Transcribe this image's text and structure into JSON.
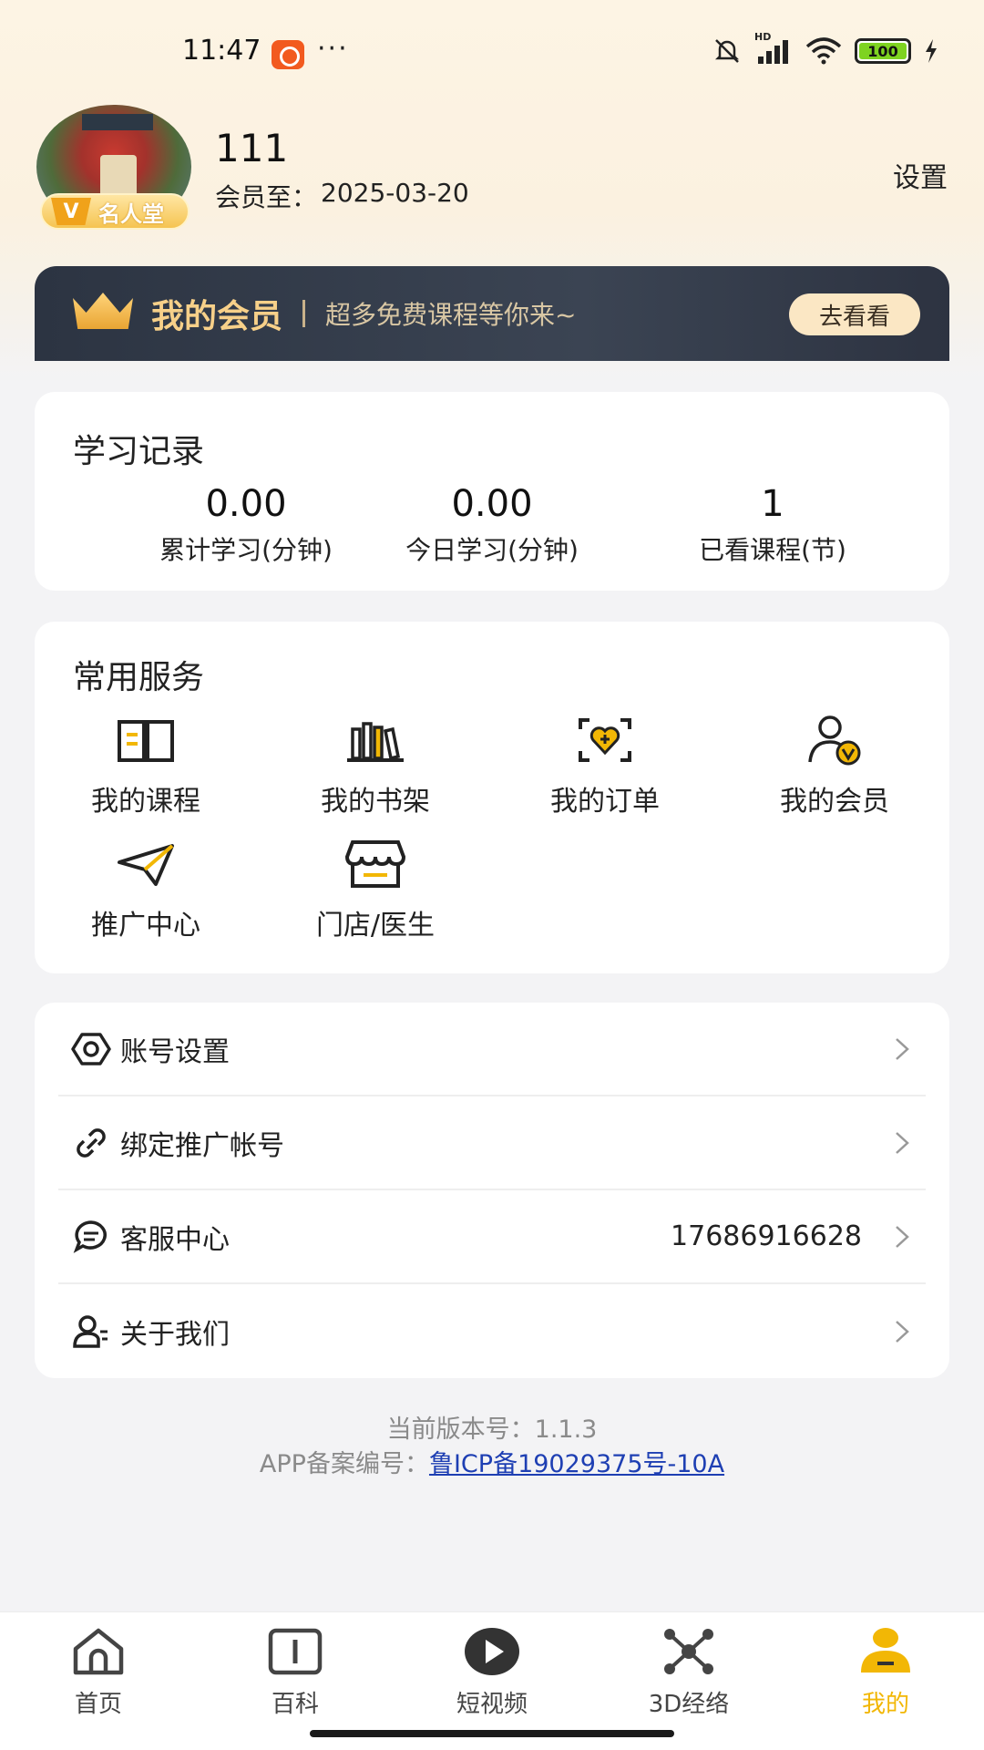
{
  "status_bar": {
    "time": "11:47",
    "dots": "···",
    "network": "HD",
    "battery": "100"
  },
  "profile": {
    "avatar_alt": "avatar",
    "badge": "名人堂",
    "badge_letter": "V",
    "username": "111",
    "member_prefix": "会员至：",
    "member_date": "2025-03-20",
    "settings_label": "设置"
  },
  "member_banner": {
    "title": "我的会员",
    "subtitle": "超多免费课程等你来~",
    "button": "去看看"
  },
  "study_record": {
    "title": "学习记录",
    "stats": [
      {
        "value": "0.00",
        "label": "累计学习(分钟)"
      },
      {
        "value": "0.00",
        "label": "今日学习(分钟)"
      },
      {
        "value": "1",
        "label": "已看课程(节)"
      }
    ]
  },
  "services": {
    "title": "常用服务",
    "items": [
      {
        "label": "我的课程",
        "icon": "book-icon"
      },
      {
        "label": "我的书架",
        "icon": "bookshelf-icon"
      },
      {
        "label": "我的订单",
        "icon": "order-icon"
      },
      {
        "label": "我的会员",
        "icon": "member-icon"
      },
      {
        "label": "推广中心",
        "icon": "paper-plane-icon"
      },
      {
        "label": "门店/医生",
        "icon": "store-icon"
      }
    ]
  },
  "menu": {
    "items": [
      {
        "label": "账号设置",
        "icon": "hexagon-settings-icon",
        "value": ""
      },
      {
        "label": "绑定推广帐号",
        "icon": "link-icon",
        "value": ""
      },
      {
        "label": "客服中心",
        "icon": "chat-icon",
        "value": "17686916628"
      },
      {
        "label": "关于我们",
        "icon": "person-info-icon",
        "value": ""
      }
    ]
  },
  "footer": {
    "version": "当前版本号：1.1.3",
    "record_prefix": "APP备案编号：",
    "record_link": "鲁ICP备19029375号-10A"
  },
  "tab_bar": {
    "tabs": [
      {
        "label": "首页",
        "icon": "home-icon",
        "active": false
      },
      {
        "label": "百科",
        "icon": "encyclopedia-icon",
        "active": false
      },
      {
        "label": "短视频",
        "icon": "play-icon",
        "active": false
      },
      {
        "label": "3D经络",
        "icon": "molecule-icon",
        "active": false
      },
      {
        "label": "我的",
        "icon": "profile-icon",
        "active": true
      }
    ],
    "active_color": "#f2b705"
  }
}
